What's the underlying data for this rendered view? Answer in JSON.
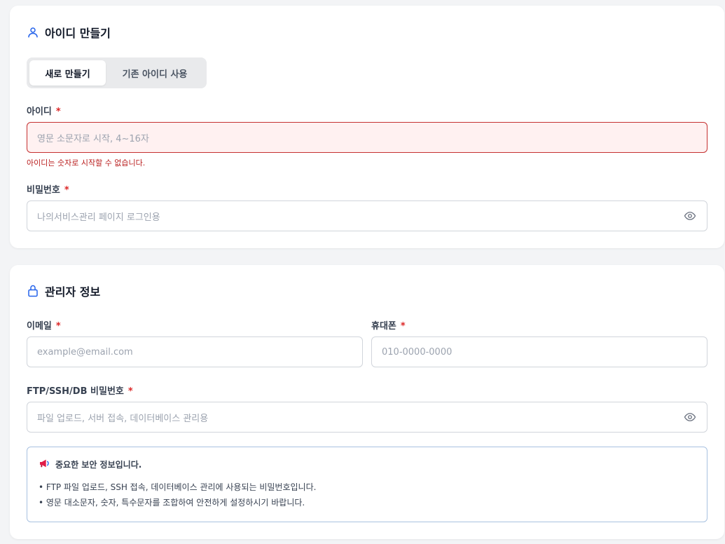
{
  "account_section": {
    "title": "아이디 만들기",
    "icon": "user-icon",
    "tabs": [
      {
        "label": "새로 만들기",
        "active": true
      },
      {
        "label": "기존 아이디 사용",
        "active": false
      }
    ],
    "id_field": {
      "label": "아이디",
      "required_mark": "*",
      "placeholder": "영문 소문자로 시작, 4~16자",
      "error": "아이디는 숫자로 시작할 수 없습니다."
    },
    "password_field": {
      "label": "비밀번호",
      "required_mark": "*",
      "placeholder": "나의서비스관리 페이지 로그인용"
    }
  },
  "admin_section": {
    "title": "관리자 정보",
    "icon": "lock-icon",
    "email_field": {
      "label": "이메일",
      "required_mark": "*",
      "placeholder": "example@email.com"
    },
    "phone_field": {
      "label": "휴대폰",
      "required_mark": "*",
      "placeholder": "010-0000-0000"
    },
    "ftp_password_field": {
      "label": "FTP/SSH/DB 비밀번호",
      "required_mark": "*",
      "placeholder": "파일 업로드, 서버 접속, 데이터베이스 관리용"
    },
    "notice": {
      "icon": "megaphone-icon",
      "title": "중요한 보안 정보입니다.",
      "lines": [
        "• FTP 파일 업로드, SSH 접속, 데이터베이스 관리에 사용되는 비밀번호입니다.",
        "• 영문 대소문자, 숫자, 특수문자를 조합하여 안전하게 설정하시기 바랍니다."
      ]
    }
  },
  "colors": {
    "accent": "#2563eb",
    "required": "#dc2626",
    "error_text": "#b91c1c",
    "error_bg": "#fff1f1",
    "notice_border": "#a8c1e0"
  }
}
